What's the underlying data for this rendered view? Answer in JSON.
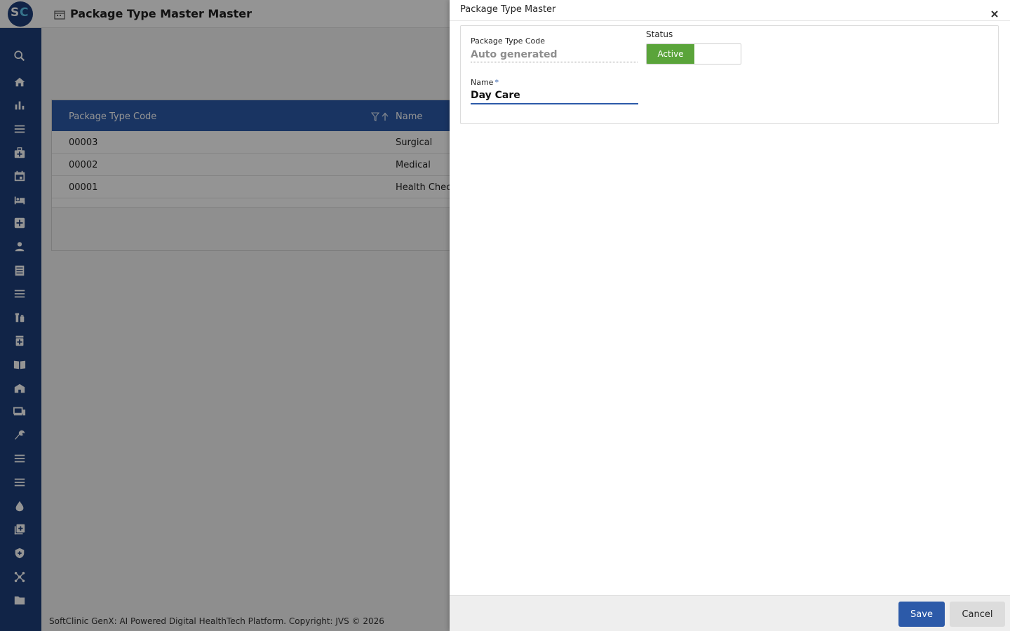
{
  "app": {
    "logo": {
      "letter_s": "S",
      "letter_c": "C"
    },
    "page_title": "Package Type Master Master",
    "footer": "SoftClinic GenX: AI Powered Digital HealthTech Platform. Copyright: JVS © 2026"
  },
  "sidebar": {
    "items": [
      "search-icon",
      "home-icon",
      "bar-chart-icon",
      "menu-icon",
      "medical-bag-icon",
      "calendar-icon",
      "bed-icon",
      "medical-plus-icon",
      "person-icon",
      "document-icon",
      "menu-icon",
      "pharmacy-icon",
      "medicine-icon",
      "book-icon",
      "building-icon",
      "devices-icon",
      "wrench-icon",
      "menu-icon",
      "menu-icon",
      "drop-icon",
      "add-box-icon",
      "shield-icon",
      "network-icon",
      "folder-icon"
    ]
  },
  "grid": {
    "columns": {
      "code": "Package Type Code",
      "name": "Name"
    },
    "rows": [
      {
        "code": "00003",
        "name": "Surgical"
      },
      {
        "code": "00002",
        "name": "Medical"
      },
      {
        "code": "00001",
        "name": "Health Chec"
      }
    ]
  },
  "drawer": {
    "title": "Package Type Master",
    "code_label": "Package Type Code",
    "code_value": "Auto generated",
    "status_label": "Status",
    "status_on": "Active",
    "name_label": "Name",
    "name_required": "*",
    "name_value": "Day Care",
    "save_label": "Save",
    "cancel_label": "Cancel"
  },
  "colors": {
    "brand": "#1e3e7a",
    "header_blue": "#2c5aa9",
    "active_green": "#5aa43a"
  }
}
